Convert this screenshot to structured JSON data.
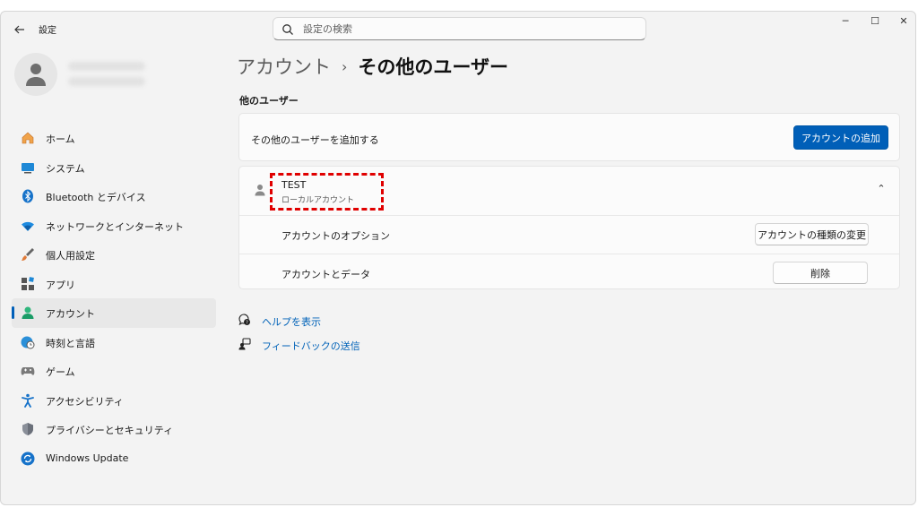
{
  "titlebar": {
    "back_icon": "back-arrow-icon",
    "title": "設定",
    "search_placeholder": "設定の検索",
    "minimize": "─",
    "maximize": "☐",
    "close": "✕"
  },
  "sidebar": {
    "items": [
      {
        "label": "ホーム",
        "icon": "home-icon"
      },
      {
        "label": "システム",
        "icon": "system-icon"
      },
      {
        "label": "Bluetooth とデバイス",
        "icon": "bluetooth-icon"
      },
      {
        "label": "ネットワークとインターネット",
        "icon": "wifi-icon"
      },
      {
        "label": "個人用設定",
        "icon": "brush-icon"
      },
      {
        "label": "アプリ",
        "icon": "apps-icon"
      },
      {
        "label": "アカウント",
        "icon": "account-icon",
        "selected": true
      },
      {
        "label": "時刻と言語",
        "icon": "globe-clock-icon"
      },
      {
        "label": "ゲーム",
        "icon": "gamepad-icon"
      },
      {
        "label": "アクセシビリティ",
        "icon": "accessibility-icon"
      },
      {
        "label": "プライバシーとセキュリティ",
        "icon": "shield-icon"
      },
      {
        "label": "Windows Update",
        "icon": "update-icon"
      }
    ]
  },
  "breadcrumb": {
    "parent": "アカウント",
    "separator": "›",
    "current": "その他のユーザー"
  },
  "section_title": "他のユーザー",
  "add_card": {
    "label": "その他のユーザーを追加する",
    "button": "アカウントの追加"
  },
  "user_card": {
    "name": "TEST",
    "type": "ローカルアカウント",
    "chevron": "⌃",
    "options_label": "アカウントのオプション",
    "options_button": "アカウントの種類の変更",
    "data_label": "アカウントとデータ",
    "data_button": "削除"
  },
  "links": {
    "help": "ヘルプを表示",
    "feedback": "フィードバックの送信"
  },
  "colors": {
    "accent": "#005fb8",
    "highlight": "#e00000",
    "link": "#0062b8"
  }
}
